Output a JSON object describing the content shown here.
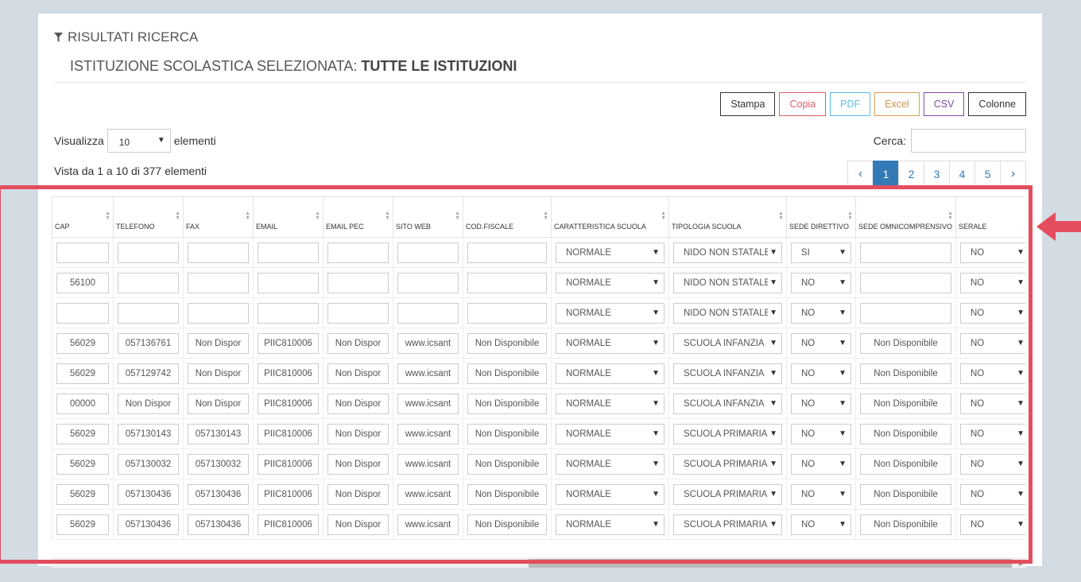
{
  "panel": {
    "title": "RISULTATI RICERCA",
    "institution_label": "ISTITUZIONE SCOLASTICA SELEZIONATA:",
    "institution_value": "TUTTE LE ISTITUZIONI"
  },
  "toolbar": {
    "stampa": "Stampa",
    "copia": "Copia",
    "pdf": "PDF",
    "excel": "Excel",
    "csv": "CSV",
    "colonne": "Colonne"
  },
  "length": {
    "prefix": "Visualizza",
    "value": "10",
    "suffix": "elementi"
  },
  "search": {
    "label": "Cerca:",
    "value": ""
  },
  "info": "Vista da 1 a 10 di 377 elementi",
  "pagination": {
    "prev": "‹",
    "pages": [
      "1",
      "2",
      "3",
      "4",
      "5"
    ],
    "next": "›",
    "active": "1"
  },
  "table": {
    "headers": [
      "CAP",
      "TELEFONO",
      "FAX",
      "EMAIL",
      "EMAIL PEC",
      "SITO WEB",
      "COD.FISCALE",
      "CARATTERISTICA SCUOLA",
      "TIPOLOGIA SCUOLA",
      "SEDE DIRETTIVO",
      "SEDE OMNICOMPRENSIVO",
      "SERALE"
    ],
    "rows": [
      [
        "",
        "",
        "",
        "",
        "",
        "",
        "",
        "NORMALE",
        "NIDO NON STATALE",
        "SI",
        "",
        "NO"
      ],
      [
        "56100",
        "",
        "",
        "",
        "",
        "",
        "",
        "NORMALE",
        "NIDO NON STATALE",
        "NO",
        "",
        "NO"
      ],
      [
        "",
        "",
        "",
        "",
        "",
        "",
        "",
        "NORMALE",
        "NIDO NON STATALE",
        "NO",
        "",
        "NO"
      ],
      [
        "56029",
        "057136761",
        "Non Dispor",
        "PIIC810006",
        "Non Dispor",
        "www.icsant",
        "Non Disponibile",
        "NORMALE",
        "SCUOLA INFANZIA",
        "NO",
        "Non Disponibile",
        "NO"
      ],
      [
        "56029",
        "057129742",
        "Non Dispor",
        "PIIC810006",
        "Non Dispor",
        "www.icsant",
        "Non Disponibile",
        "NORMALE",
        "SCUOLA INFANZIA",
        "NO",
        "Non Disponibile",
        "NO"
      ],
      [
        "00000",
        "Non Dispor",
        "Non Dispor",
        "PIIC810006",
        "Non Dispor",
        "www.icsant",
        "Non Disponibile",
        "NORMALE",
        "SCUOLA INFANZIA",
        "NO",
        "Non Disponibile",
        "NO"
      ],
      [
        "56029",
        "057130143",
        "057130143",
        "PIIC810006",
        "Non Dispor",
        "www.icsant",
        "Non Disponibile",
        "NORMALE",
        "SCUOLA PRIMARIA",
        "NO",
        "Non Disponibile",
        "NO"
      ],
      [
        "56029",
        "057130032",
        "057130032",
        "PIIC810006",
        "Non Dispor",
        "www.icsant",
        "Non Disponibile",
        "NORMALE",
        "SCUOLA PRIMARIA",
        "NO",
        "Non Disponibile",
        "NO"
      ],
      [
        "56029",
        "057130436",
        "057130436",
        "PIIC810006",
        "Non Dispor",
        "www.icsant",
        "Non Disponibile",
        "NORMALE",
        "SCUOLA PRIMARIA",
        "NO",
        "Non Disponibile",
        "NO"
      ],
      [
        "56029",
        "057130436",
        "057130436",
        "PIIC810006",
        "Non Dispor",
        "www.icsant",
        "Non Disponibile",
        "NORMALE",
        "SCUOLA PRIMARIA",
        "NO",
        "Non Disponibile",
        "NO"
      ]
    ],
    "select_columns": [
      7,
      8,
      9,
      11
    ]
  },
  "colors": {
    "highlight": "#e34d5d",
    "accent": "#337ab7"
  },
  "icons": {
    "filter": "filter-icon",
    "highlight_arrow": "arrow-left-icon"
  }
}
